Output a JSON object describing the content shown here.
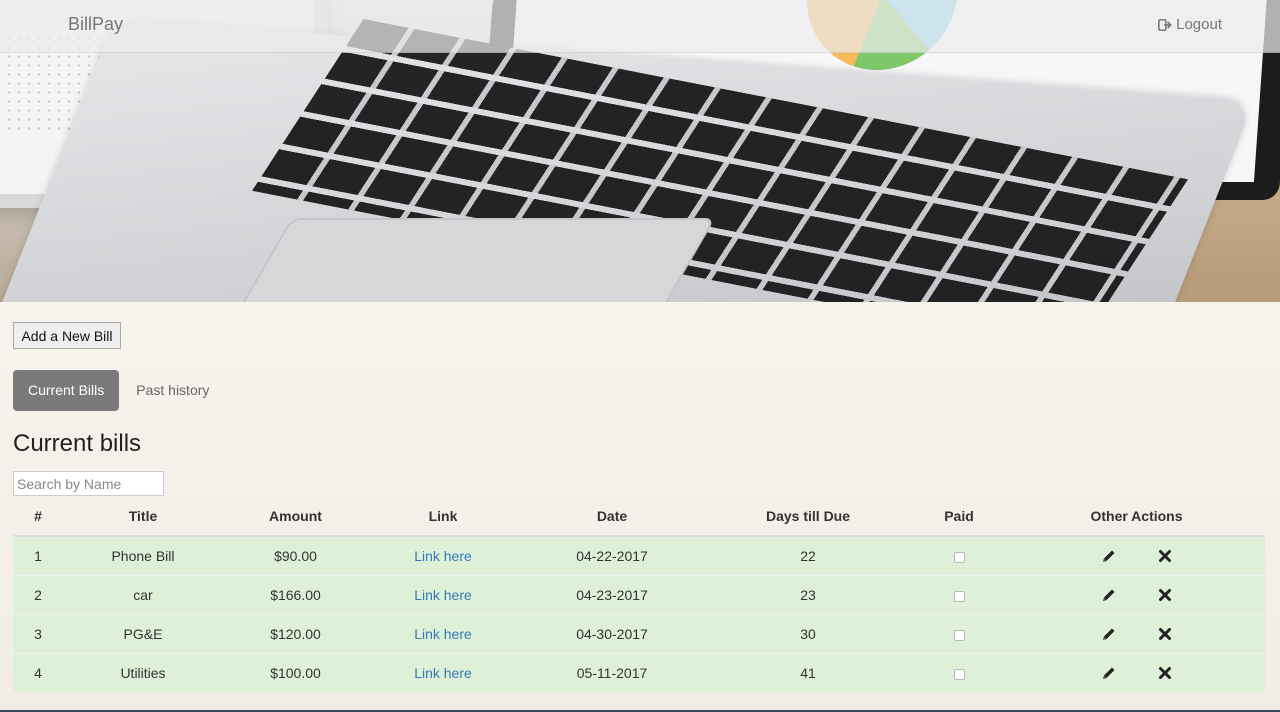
{
  "navbar": {
    "brand": "BillPay",
    "logout_label": "Logout",
    "logout_icon": "sign-out-icon"
  },
  "add_bill_label": "Add a New Bill",
  "tabs": [
    {
      "label": "Current Bills",
      "active": true
    },
    {
      "label": "Past history",
      "active": false
    }
  ],
  "page_title": "Current bills",
  "search": {
    "placeholder": "Search by Name",
    "value": ""
  },
  "table": {
    "headers": [
      "#",
      "Title",
      "Amount",
      "Link",
      "Date",
      "Days till Due",
      "Paid",
      "Other Actions"
    ],
    "rows": [
      {
        "num": "1",
        "title": "Phone Bill",
        "amount": "$90.00",
        "link": "Link here",
        "date": "04-22-2017",
        "days": "22",
        "paid": false
      },
      {
        "num": "2",
        "title": "car",
        "amount": "$166.00",
        "link": "Link here",
        "date": "04-23-2017",
        "days": "23",
        "paid": false
      },
      {
        "num": "3",
        "title": "PG&E",
        "amount": "$120.00",
        "link": "Link here",
        "date": "04-30-2017",
        "days": "30",
        "paid": false
      },
      {
        "num": "4",
        "title": "Utilities",
        "amount": "$100.00",
        "link": "Link here",
        "date": "05-11-2017",
        "days": "41",
        "paid": false
      }
    ],
    "row_action_icons": [
      "pencil-icon",
      "remove-icon"
    ]
  },
  "colors": {
    "row_success": "#dff0d8",
    "link": "#337ab7",
    "active_tab": "#7a7a7a"
  }
}
